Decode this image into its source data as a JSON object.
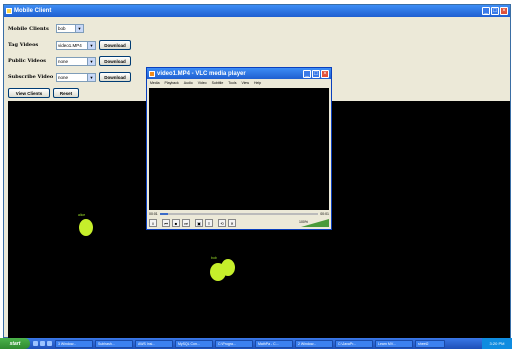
{
  "window": {
    "title": "Mobile Client"
  },
  "form": {
    "mobile_clients": {
      "label": "Mobile Clients",
      "value": "bob"
    },
    "tag_videos": {
      "label": "Tag Videos",
      "value": "video1.MP4",
      "button": "Download"
    },
    "public_videos": {
      "label": "Public Videos",
      "value": "none",
      "button": "Download"
    },
    "subscribe_video": {
      "label": "Subscribe Video",
      "value": "none",
      "button": "Download"
    },
    "view_clients_button": "View Clients",
    "reset_button": "Reset"
  },
  "nodes": [
    {
      "label": "alice"
    },
    {
      "label": "bob"
    }
  ],
  "vlc": {
    "title": "video1.MP4 - VLC media player",
    "menu": [
      "Media",
      "Playback",
      "Audio",
      "Video",
      "Subtitle",
      "Tools",
      "View",
      "Help"
    ],
    "time_elapsed": "00:01",
    "time_total": "00:01",
    "progress": 0.05,
    "volume": "100%"
  },
  "taskbar": {
    "start_label": "start",
    "tasks": [
      "3 Window...",
      "Subhash...",
      "AWS Insi...",
      "MySQL Con...",
      "C:\\Progra...",
      "MathPa - C...",
      "2 Window...",
      "C:\\JavaPr...",
      "Learn MV...",
      "sheet2"
    ],
    "clock": "3:20 PM"
  },
  "colors": {
    "accent": "#1f5fd0",
    "node": "#c6ef2b",
    "canvas": "#000000"
  }
}
